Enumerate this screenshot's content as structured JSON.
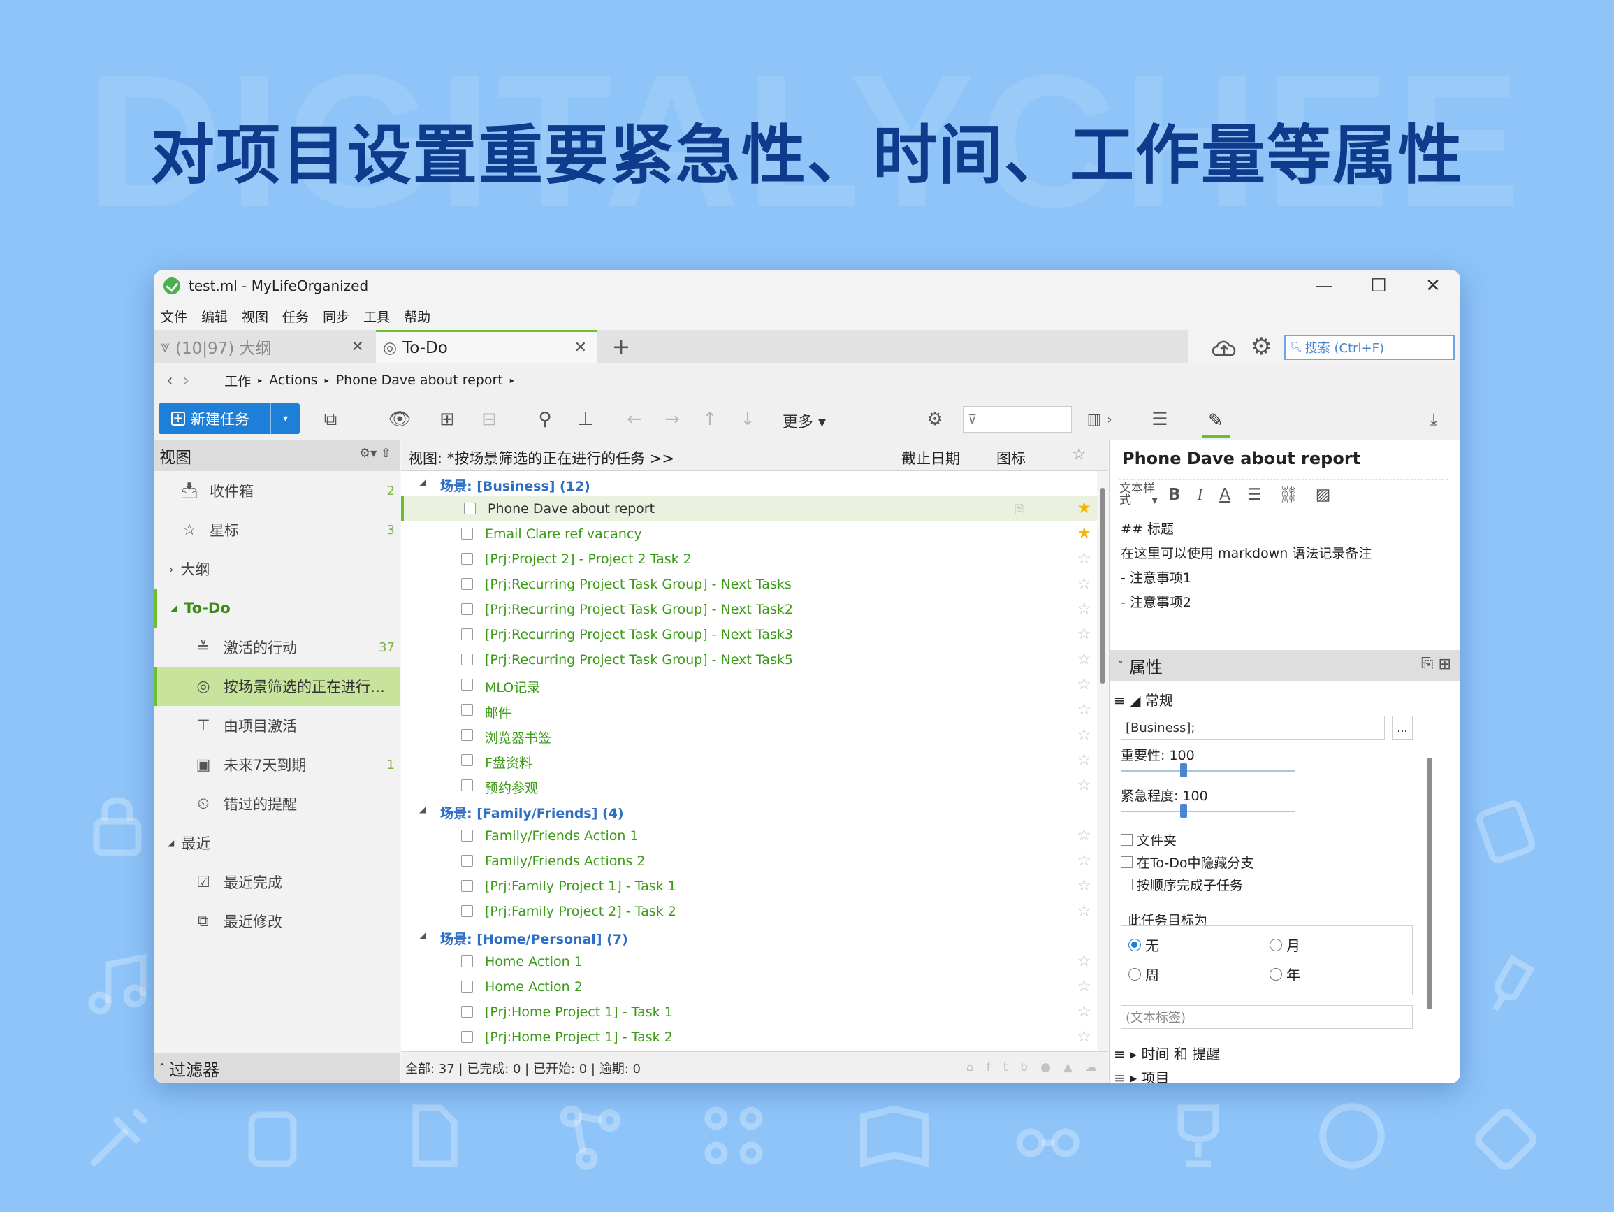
{
  "hero": {
    "watermark": "DIGITALYCHEE",
    "headline": "对项目设置重要紧急性、时间、工作量等属性"
  },
  "window": {
    "title": "test.ml - MyLifeOrganized",
    "controls": {
      "min": "—",
      "max": "☐",
      "close": "✕"
    }
  },
  "menu": [
    "文件",
    "编辑",
    "视图",
    "任务",
    "同步",
    "工具",
    "帮助"
  ],
  "tabs": [
    {
      "label": "(10|97) 大纲",
      "close": "✕"
    },
    {
      "label": "To-Do",
      "close": "✕"
    }
  ],
  "tab_add": "+",
  "search": {
    "placeholder": "搜索 (Ctrl+F)"
  },
  "breadcrumb": [
    "工作",
    "Actions",
    "Phone Dave about report"
  ],
  "toolbar": {
    "new_task": "新建任务",
    "more": "更多"
  },
  "left": {
    "header": "视图",
    "items": [
      {
        "label": "收件箱",
        "count": "2"
      },
      {
        "label": "星标",
        "count": "3"
      },
      {
        "label": "大纲",
        "count": ""
      },
      {
        "label": "To-Do",
        "count": ""
      },
      {
        "label": "激活的行动",
        "count": "37"
      },
      {
        "label": "按场景筛选的正在进行…",
        "count": ""
      },
      {
        "label": "由项目激活",
        "count": ""
      },
      {
        "label": "未来7天到期",
        "count": "1"
      },
      {
        "label": "错过的提醒",
        "count": ""
      },
      {
        "label": "最近",
        "count": ""
      },
      {
        "label": "最近完成",
        "count": ""
      },
      {
        "label": "最近修改",
        "count": ""
      }
    ],
    "footer": "过滤器"
  },
  "grid": {
    "view_label": "视图: *按场景筛选的正在进行的任务 >>",
    "col_due": "截止日期",
    "col_icon": "图标",
    "rows": [
      {
        "type": "context",
        "text": "场景: [Business]   (12)",
        "star": false
      },
      {
        "type": "task",
        "text": "Phone Dave about report",
        "star": true
      },
      {
        "type": "task",
        "text": "Email Clare ref vacancy",
        "star": true
      },
      {
        "type": "task",
        "text": "[Prj:Project 2] - Project 2 Task 2",
        "star": false
      },
      {
        "type": "task",
        "text": "[Prj:Recurring Project Task Group] - Next Tasks",
        "star": false
      },
      {
        "type": "task",
        "text": "[Prj:Recurring Project Task Group] - Next Task2",
        "star": false
      },
      {
        "type": "task",
        "text": "[Prj:Recurring Project Task Group] - Next Task3",
        "star": false
      },
      {
        "type": "task",
        "text": "[Prj:Recurring Project Task Group] - Next Task5",
        "star": false
      },
      {
        "type": "task",
        "text": "MLO记录",
        "star": false
      },
      {
        "type": "task",
        "text": "邮件",
        "star": false
      },
      {
        "type": "task",
        "text": "浏览器书签",
        "star": false
      },
      {
        "type": "task",
        "text": "F盘资料",
        "star": false
      },
      {
        "type": "task",
        "text": "预约参观",
        "star": false
      },
      {
        "type": "context",
        "text": "场景: [Family/Friends]   (4)",
        "star": false
      },
      {
        "type": "task",
        "text": "Family/Friends Action 1",
        "star": false
      },
      {
        "type": "task",
        "text": "Family/Friends Actions 2",
        "star": false
      },
      {
        "type": "task",
        "text": "[Prj:Family Project 1] - Task 1",
        "star": false
      },
      {
        "type": "task",
        "text": "[Prj:Family Project 2] - Task 2",
        "star": false
      },
      {
        "type": "context",
        "text": "场景: [Home/Personal]   (7)",
        "star": false
      },
      {
        "type": "task",
        "text": "Home Action 1",
        "star": false
      },
      {
        "type": "task",
        "text": "Home Action 2",
        "star": false
      },
      {
        "type": "task",
        "text": "[Prj:Home Project 1] - Task 1",
        "star": false
      },
      {
        "type": "task",
        "text": "[Prj:Home Project 1] - Task 2",
        "star": false
      }
    ],
    "status": "全部: 37 | 已完成: 0 | 已开始: 0 | 逾期: 0"
  },
  "note": {
    "title": "Phone Dave about report",
    "style_label": "文本样式",
    "lines": [
      "## 标题",
      "在这里可以使用 markdown 语法记录备注",
      "- 注意事项1",
      "- 注意事项2"
    ]
  },
  "props": {
    "header": "属性",
    "general": "常规",
    "context_value": "[Business];",
    "browse": "...",
    "importance": "重要性: 100",
    "importance_value": 100,
    "urgency": "紧急程度: 100",
    "urgency_value": 100,
    "folder": "文件夹",
    "hide_branch": "在To-Do中隐藏分支",
    "sequential": "按顺序完成子任务",
    "goal_title": "此任务目标为",
    "goal_options": [
      "无",
      "月",
      "周",
      "年"
    ],
    "goal_selected": "无",
    "tag_placeholder": "(文本标签)",
    "section_time": "时间 和 提醒",
    "section_project": "项目"
  }
}
